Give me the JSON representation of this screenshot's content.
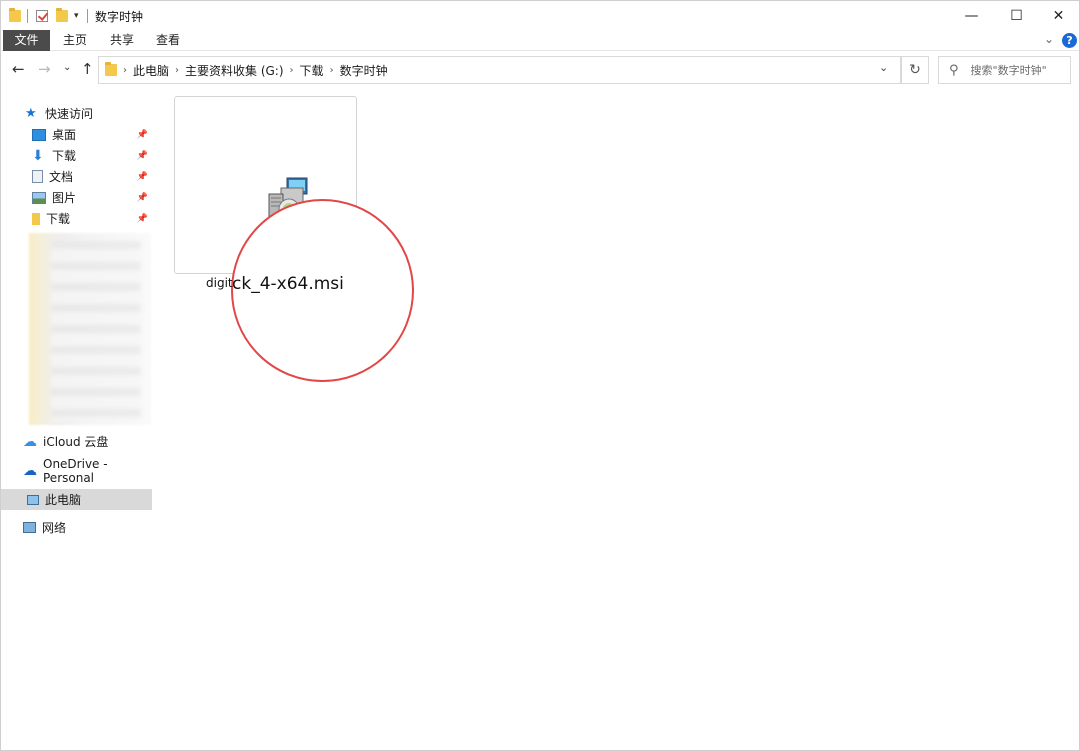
{
  "window": {
    "title": "数字时钟",
    "controls": {
      "minimize": "—",
      "maximize": "☐",
      "close": "✕"
    }
  },
  "ribbon": {
    "tabs": [
      "文件",
      "主页",
      "共享",
      "查看"
    ],
    "help": "?"
  },
  "nav": {
    "breadcrumbs": [
      "此电脑",
      "主要资料收集 (G:)",
      "下载",
      "数字时钟"
    ],
    "search_placeholder": "搜索\"数字时钟\""
  },
  "sidebar": {
    "quick_access": "快速访问",
    "pinned": [
      {
        "label": "桌面",
        "icon": "desktop-icon"
      },
      {
        "label": "下载",
        "icon": "download-icon"
      },
      {
        "label": "文档",
        "icon": "document-icon"
      },
      {
        "label": "图片",
        "icon": "picture-icon"
      },
      {
        "label": "下载",
        "icon": "folder-icon"
      }
    ],
    "icloud": "iCloud 云盘",
    "onedrive": "OneDrive - Personal",
    "this_pc": "此电脑",
    "network": "网络"
  },
  "main": {
    "file": {
      "name_prefix": "digit",
      "name_zoomed": "ck_4-x64.msi",
      "icon": "msi-installer-icon"
    }
  },
  "colors": {
    "file_tab_bg": "#4b4b4b",
    "help_blue": "#1a6ad6",
    "highlight_circle": "#e24646",
    "selected_bg": "#d9d9d9"
  }
}
